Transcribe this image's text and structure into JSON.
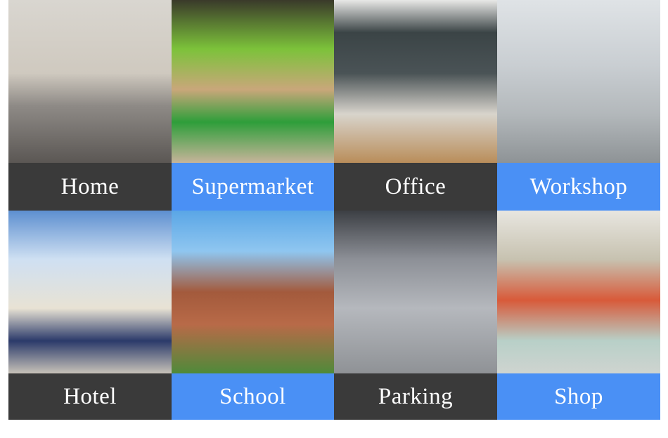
{
  "colors": {
    "dark_label": "#3a3a3a",
    "blue_label": "#4a90f5",
    "label_text": "#ffffff"
  },
  "tiles": [
    {
      "label": "Home",
      "style": "dark"
    },
    {
      "label": "Supermarket",
      "style": "blue"
    },
    {
      "label": "Office",
      "style": "dark"
    },
    {
      "label": "Workshop",
      "style": "blue"
    },
    {
      "label": "Hotel",
      "style": "dark"
    },
    {
      "label": "School",
      "style": "blue"
    },
    {
      "label": "Parking",
      "style": "dark"
    },
    {
      "label": "Shop",
      "style": "blue"
    }
  ]
}
